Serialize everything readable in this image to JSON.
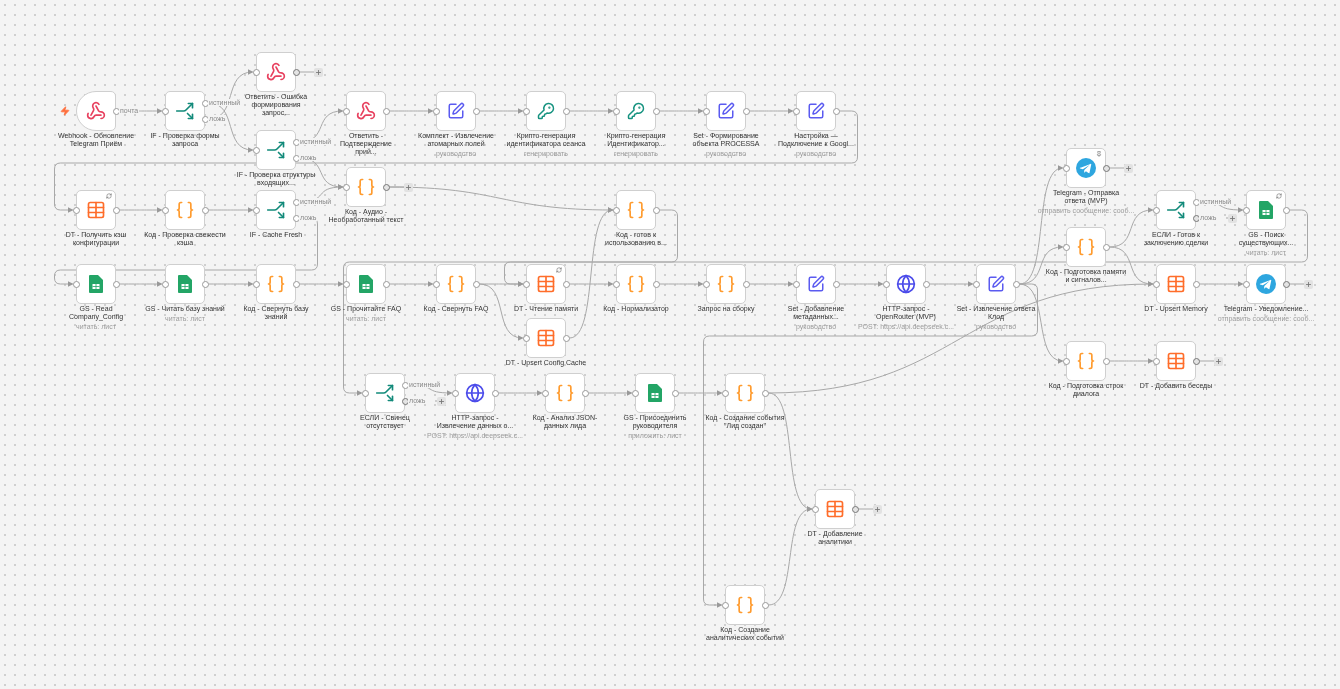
{
  "nodes": [
    {
      "kind": "webhook",
      "title": "Ответить - Ошибка формирования запрос...",
      "outputs": [
        {
          "dangling": true
        }
      ]
    },
    {
      "kind": "webhook",
      "trigger": true,
      "title": "Webhook - Обновление Telegram Приём",
      "outputs": [
        {
          "label": "почта",
          "dangling": false
        }
      ]
    },
    {
      "kind": "if",
      "title": "IF - Проверка формы запроса",
      "outputs": [
        {
          "label": "истинный",
          "dangling": false
        },
        {
          "label": "ложь",
          "dangling": false
        }
      ]
    },
    {
      "kind": "if",
      "title": "IF - Проверка структуры входящих...",
      "outputs": [
        {
          "label": "истинный",
          "dangling": false
        },
        {
          "label": "ложь",
          "dangling": false
        }
      ]
    },
    {
      "kind": "webhook",
      "title": "Ответить - Подтверждение прий...",
      "outputs": [
        {
          "dangling": false
        }
      ]
    },
    {
      "kind": "set",
      "title": "Комплект - Извлечение атомарных полей",
      "subtitle": "руководство",
      "outputs": [
        {
          "dangling": false
        }
      ]
    },
    {
      "kind": "crypto",
      "title": "Крипто-генерация идентификатора сеанса",
      "subtitle": "генерировать",
      "outputs": [
        {
          "dangling": false
        }
      ]
    },
    {
      "kind": "crypto",
      "title": "Крипто-генерация Идентификатор...",
      "subtitle": "генерировать",
      "outputs": [
        {
          "dangling": false
        }
      ]
    },
    {
      "kind": "set",
      "title": "Set - Формирование объекта PROCESSA",
      "subtitle": "руководство",
      "outputs": [
        {
          "dangling": false
        }
      ]
    },
    {
      "kind": "set",
      "title": "Настройка — Подключение к Googl...",
      "subtitle": "руководство",
      "outputs": [
        {
          "dangling": false
        }
      ]
    },
    {
      "kind": "telegram",
      "title": "Telegram - Отправка ответа (MVP)",
      "subtitle": "отправить сообщение: сооб...",
      "outputs": [
        {
          "dangling": true
        }
      ]
    },
    {
      "kind": "code",
      "title": "Код - Аудио - Необработанный текст",
      "outputs": [
        {
          "dangling": true
        }
      ]
    },
    {
      "kind": "table",
      "title": "DT - Получить кэш конфигурации",
      "outputs": [
        {
          "dangling": false
        }
      ]
    },
    {
      "kind": "code",
      "title": "Код - Проверка свежести кэша",
      "outputs": [
        {
          "dangling": false
        }
      ]
    },
    {
      "kind": "if",
      "title": "IF - Cache Fresh",
      "outputs": [
        {
          "label": "истинный",
          "dangling": false
        },
        {
          "label": "ложь",
          "dangling": false
        }
      ]
    },
    {
      "kind": "code",
      "title": "Код - готов к использованию в...",
      "outputs": [
        {
          "dangling": false
        }
      ]
    },
    {
      "kind": "if",
      "title": "ЕСЛИ - Готов к заключению сделки",
      "outputs": [
        {
          "label": "истинный",
          "dangling": false
        },
        {
          "label": "ложь",
          "dangling": true
        }
      ]
    },
    {
      "kind": "sheet",
      "title": "GS - Поиск существующих...",
      "subtitle": "читать: лист",
      "outputs": [
        {
          "dangling": false
        }
      ]
    },
    {
      "kind": "code",
      "title": "Код - Подготовка памяти и сигналов...",
      "outputs": [
        {
          "dangling": false
        }
      ]
    },
    {
      "kind": "sheet",
      "title": "GS - Read Company_Config",
      "subtitle": "читать: лист",
      "outputs": [
        {
          "dangling": false
        }
      ]
    },
    {
      "kind": "sheet",
      "title": "GS - Читать базу знаний",
      "subtitle": "читать: лист",
      "outputs": [
        {
          "dangling": false
        }
      ]
    },
    {
      "kind": "code",
      "title": "Код - Свернуть базу знаний",
      "outputs": [
        {
          "dangling": false
        }
      ]
    },
    {
      "kind": "sheet",
      "title": "GS - Прочитайте FAQ",
      "subtitle": "читать: лист",
      "outputs": [
        {
          "dangling": false
        }
      ]
    },
    {
      "kind": "code",
      "title": "Код - Свернуть FAQ",
      "outputs": [
        {
          "dangling": false
        }
      ]
    },
    {
      "kind": "table",
      "title": "DT - Чтение памяти",
      "outputs": [
        {
          "dangling": false
        }
      ]
    },
    {
      "kind": "code",
      "title": "Код - Нормализатор",
      "outputs": [
        {
          "dangling": false
        }
      ]
    },
    {
      "kind": "code",
      "title": "Запрос на сборку",
      "outputs": [
        {
          "dangling": false
        }
      ]
    },
    {
      "kind": "set",
      "title": "Set - Добавление метаданных...",
      "subtitle": "руководство",
      "outputs": [
        {
          "dangling": false
        }
      ]
    },
    {
      "kind": "http",
      "title": "HTTP-запрос - OpenRouter (MVP)",
      "subtitle": "POST: https://api.deepseek.c...",
      "outputs": [
        {
          "dangling": false
        }
      ]
    },
    {
      "kind": "set",
      "title": "Set - Извлечение ответа Клод",
      "subtitle": "руководство",
      "outputs": [
        {
          "dangling": false
        }
      ]
    },
    {
      "kind": "table",
      "title": "DT - Upsert Memory",
      "outputs": [
        {
          "dangling": false
        }
      ]
    },
    {
      "kind": "telegram",
      "title": "Telegram - Уведомление...",
      "subtitle": "отправить сообщение: сооб...",
      "outputs": [
        {
          "dangling": true
        }
      ]
    },
    {
      "kind": "if",
      "title": "ЕСЛИ - Свинец отсутствует",
      "outputs": [
        {
          "label": "истинный",
          "dangling": false
        },
        {
          "label": "ложь",
          "dangling": true
        }
      ]
    },
    {
      "kind": "http",
      "title": "HTTP-запрос - Извлечение данных о...",
      "subtitle": "POST: https://api.deepseek.c...",
      "outputs": [
        {
          "dangling": false
        }
      ]
    },
    {
      "kind": "table",
      "title": "DT - Upsert Config Cache",
      "outputs": [
        {
          "dangling": false
        }
      ]
    },
    {
      "kind": "code",
      "title": "Код - Анализ JSON-данных лида",
      "outputs": [
        {
          "dangling": false
        }
      ]
    },
    {
      "kind": "sheet",
      "title": "GS - Присоединить руководителя",
      "subtitle": "приложить: лист",
      "outputs": [
        {
          "dangling": false
        }
      ]
    },
    {
      "kind": "code",
      "title": "Код - Создание события \"Лид создан\"",
      "outputs": [
        {
          "dangling": false
        }
      ]
    },
    {
      "kind": "code",
      "title": "Код - Подготовка строк диалога",
      "outputs": [
        {
          "dangling": false
        }
      ]
    },
    {
      "kind": "table",
      "title": "DT - Добавить беседы",
      "outputs": [
        {
          "dangling": true
        }
      ]
    },
    {
      "kind": "table",
      "title": "DT - Добавление аналитики",
      "outputs": [
        {
          "dangling": true
        }
      ]
    },
    {
      "kind": "code",
      "title": "Код - Создание аналитических событий",
      "outputs": [
        {
          "dangling": false
        }
      ]
    }
  ]
}
